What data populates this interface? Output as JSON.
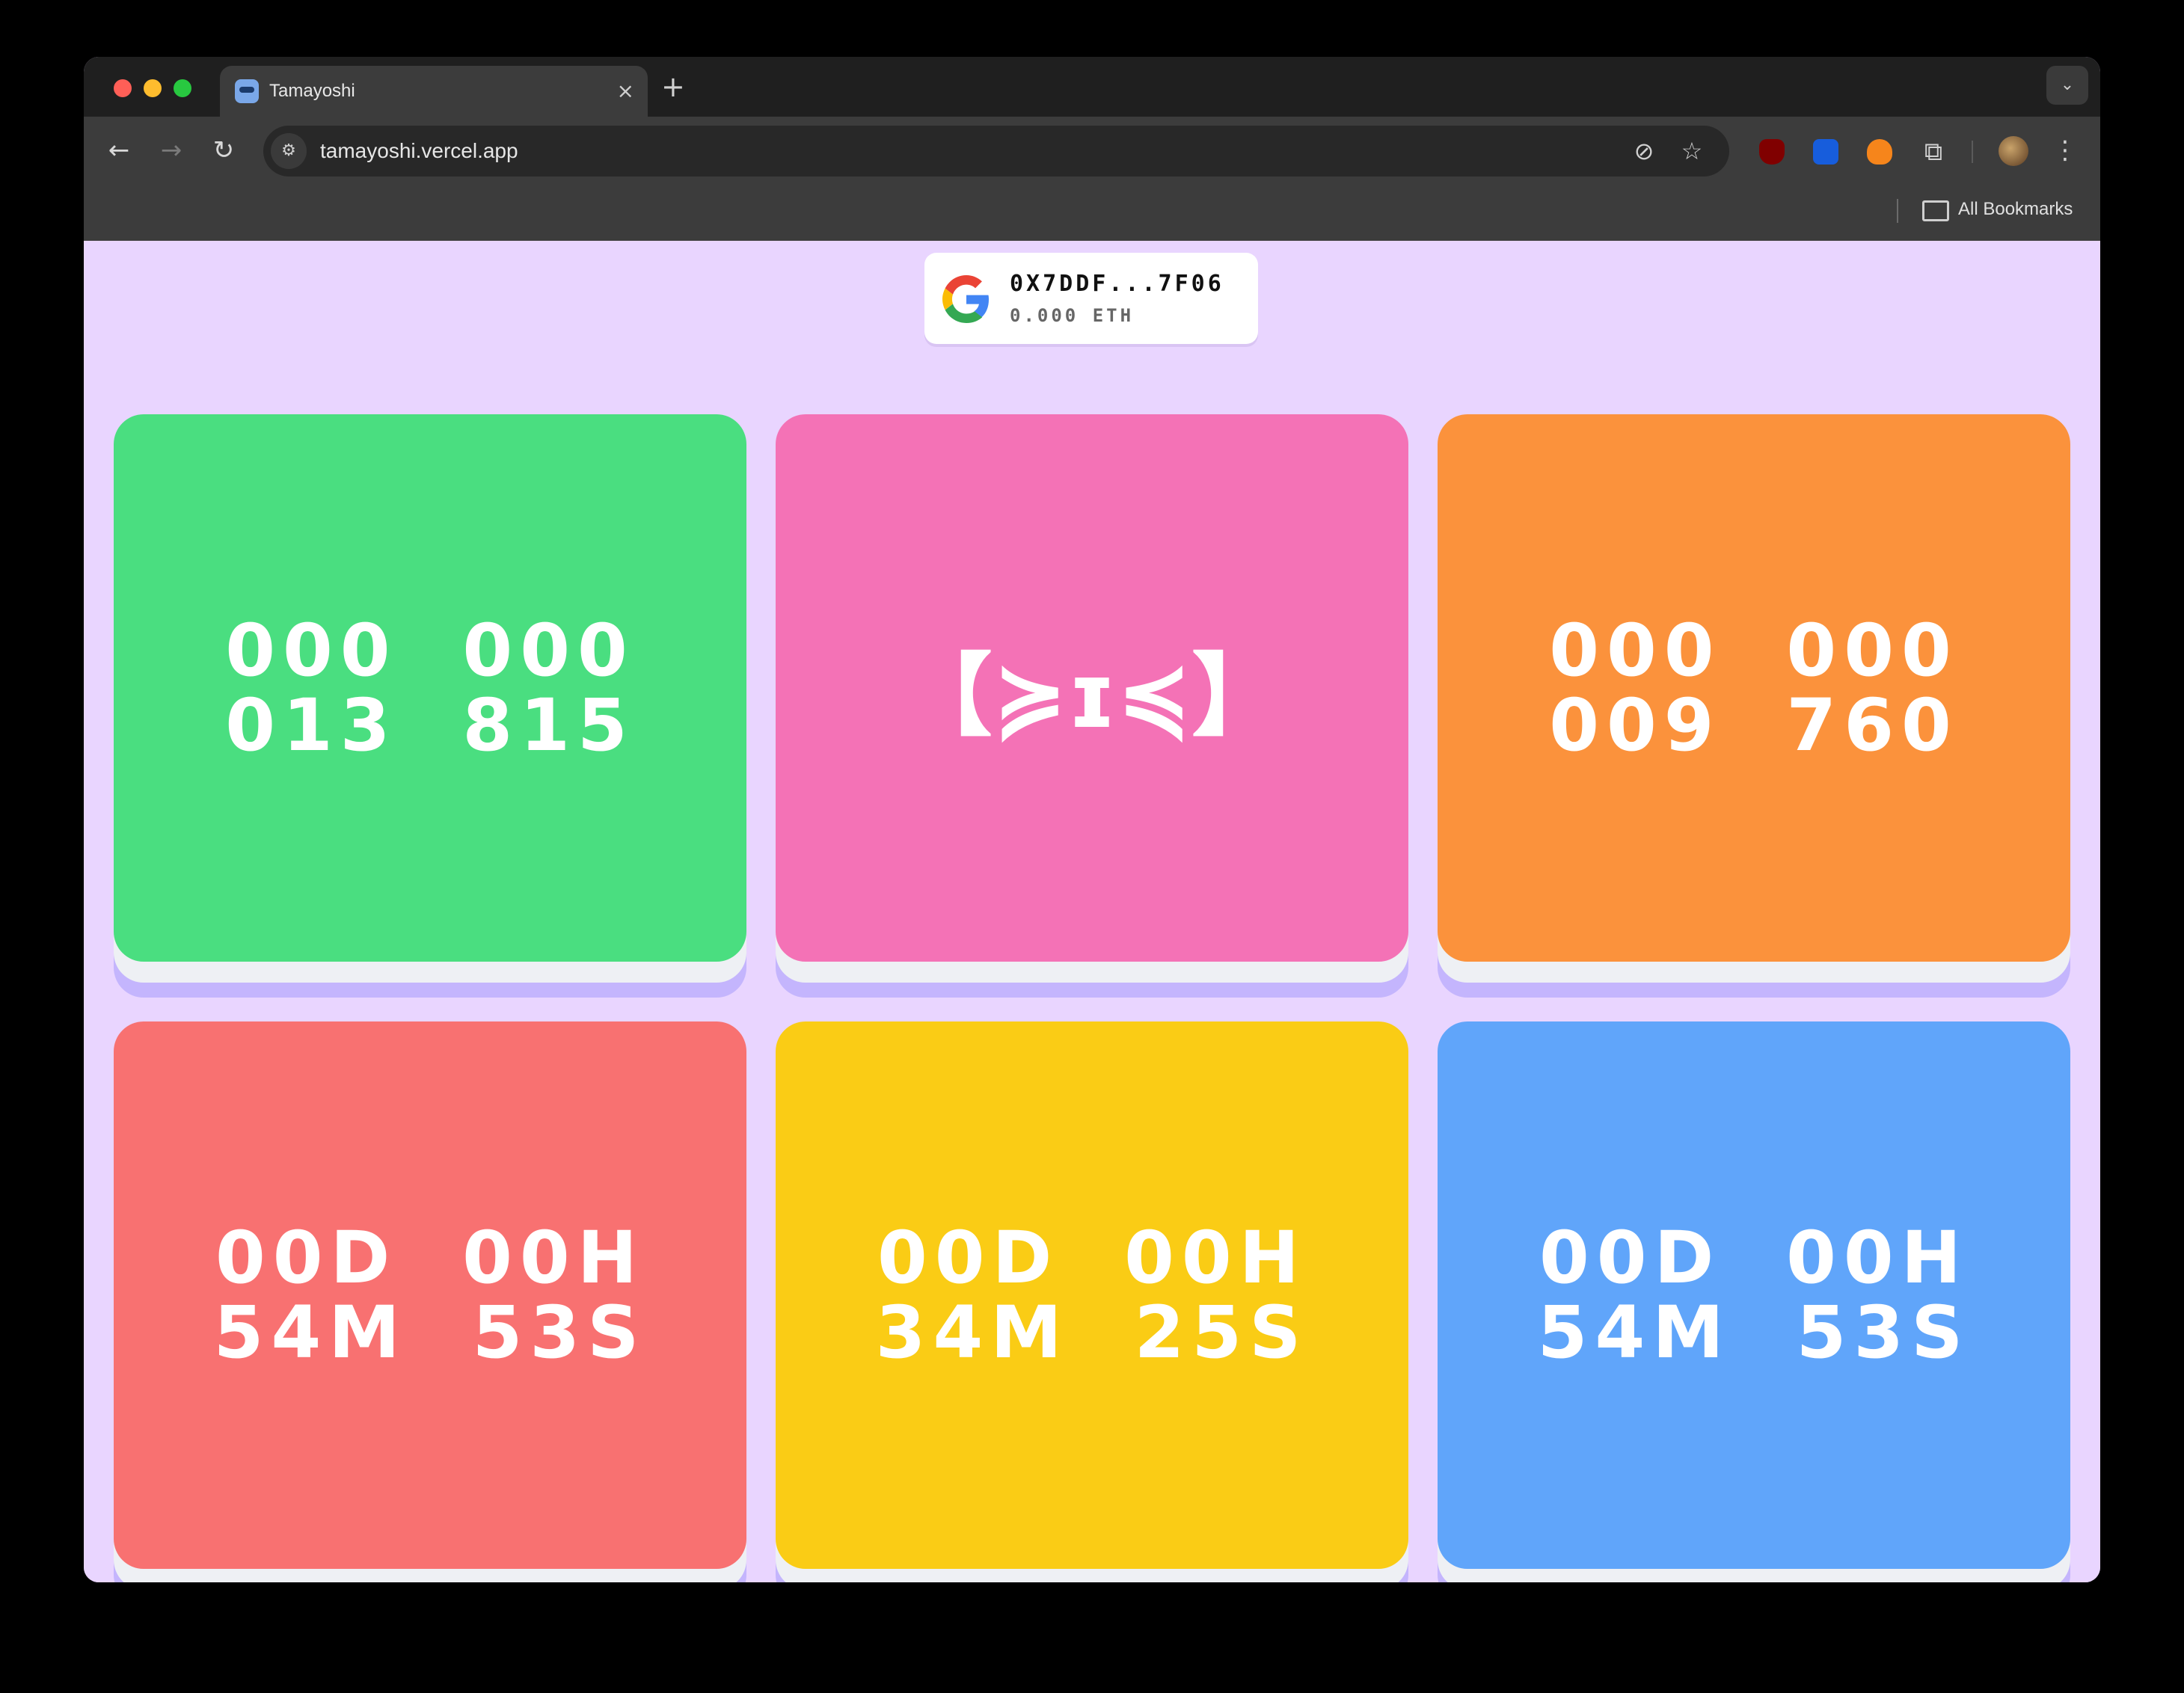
{
  "browser": {
    "tab_title": "Tamayoshi",
    "new_tab": "+",
    "close": "×",
    "url": "tamayoshi.vercel.app",
    "bookmarks_label": "All Bookmarks"
  },
  "wallet": {
    "address": "0X7DDF...7F06",
    "balance": "0.000 ETH"
  },
  "cards": [
    {
      "color": "#4ade80",
      "line1": "000  000",
      "line2": "013  815"
    },
    {
      "color": "#f472b6",
      "face": "【≽ɪ≼】"
    },
    {
      "color": "#fb923c",
      "line1": "000  000",
      "line2": "009  760"
    },
    {
      "color": "#f87171",
      "line1": "00D  00H",
      "line2": "54M  53S"
    },
    {
      "color": "#facc15",
      "line1": "00D  00H",
      "line2": "34M  25S"
    },
    {
      "color": "#60a5fa",
      "line1": "00D  00H",
      "line2": "54M  53S"
    }
  ],
  "icons": {
    "back": "arrow-left-icon",
    "forward": "arrow-right-icon",
    "reload": "reload-icon",
    "eye": "eye-off-icon",
    "star": "star-icon",
    "folder": "folder-icon"
  }
}
